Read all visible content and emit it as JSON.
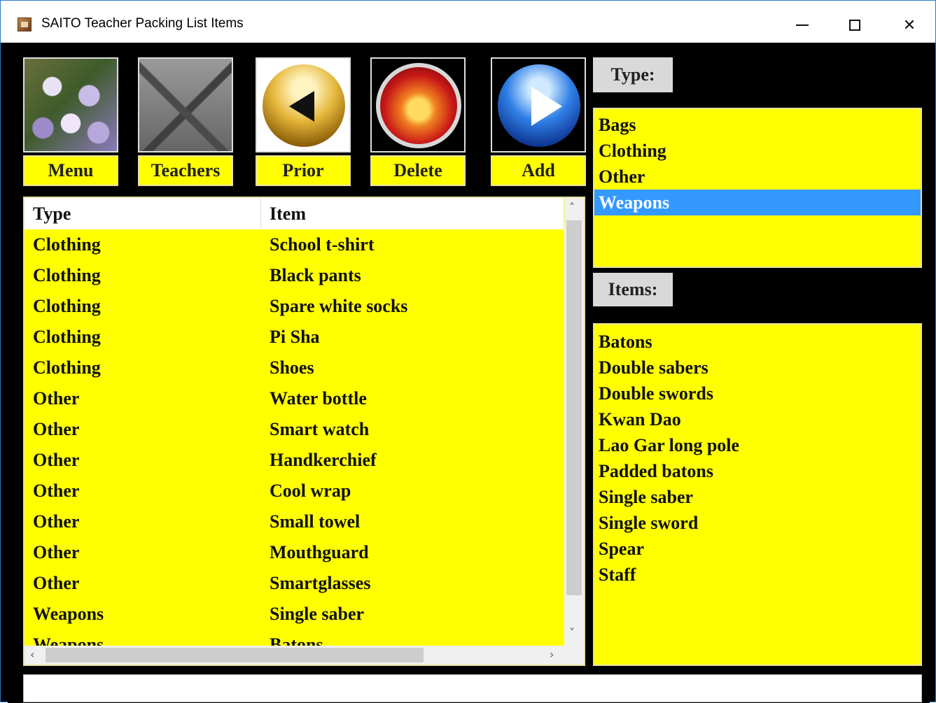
{
  "window": {
    "title": "SAITO Teacher Packing List Items"
  },
  "titlebar": {
    "minimize": "—",
    "maximize": "☐",
    "close": "✕"
  },
  "toolbar": [
    {
      "label": "Menu"
    },
    {
      "label": "Teachers"
    },
    {
      "label": "Prior"
    },
    {
      "label": "Delete"
    },
    {
      "label": "Add"
    }
  ],
  "grid": {
    "headers": {
      "type": "Type",
      "item": "Item"
    },
    "rows": [
      {
        "type": "Clothing",
        "item": "School t-shirt"
      },
      {
        "type": "Clothing",
        "item": "Black pants"
      },
      {
        "type": "Clothing",
        "item": "Spare white socks"
      },
      {
        "type": "Clothing",
        "item": "Pi Sha"
      },
      {
        "type": "Clothing",
        "item": "Shoes"
      },
      {
        "type": "Other",
        "item": "Water bottle"
      },
      {
        "type": "Other",
        "item": "Smart watch"
      },
      {
        "type": "Other",
        "item": "Handkerchief"
      },
      {
        "type": "Other",
        "item": "Cool wrap"
      },
      {
        "type": "Other",
        "item": "Small towel"
      },
      {
        "type": "Other",
        "item": "Mouthguard"
      },
      {
        "type": "Other",
        "item": "Smartglasses"
      },
      {
        "type": "Weapons",
        "item": "Single saber"
      },
      {
        "type": "Weapons",
        "item": "Batons"
      }
    ]
  },
  "type_panel": {
    "caption": "Type:",
    "options": [
      "Bags",
      "Clothing",
      "Other",
      "Weapons"
    ],
    "selected": "Weapons"
  },
  "items_panel": {
    "caption": "Items:",
    "options": [
      "Batons",
      "Double sabers",
      "Double swords",
      "Kwan Dao",
      "Lao Gar long pole",
      "Padded batons",
      "Single saber",
      "Single sword",
      "Spear",
      "Staff"
    ]
  },
  "status": {
    "text": ""
  },
  "colors": {
    "panel": "#ffff00",
    "selection": "#3399ff",
    "background": "#000000"
  }
}
